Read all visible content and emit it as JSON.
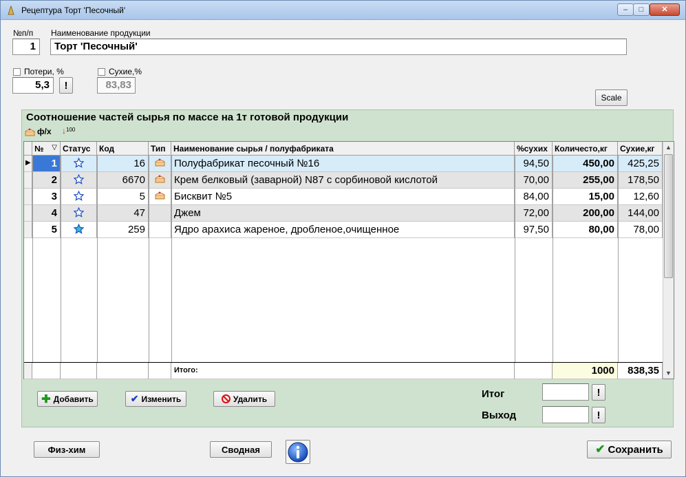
{
  "window": {
    "title": "Рецептура Торт 'Песочный'",
    "controls": {
      "minimize": "–",
      "maximize": "□",
      "close": "✕"
    }
  },
  "form": {
    "num_label": "№п/п",
    "num_value": "1",
    "name_label": "Наименование продукции",
    "name_value": "Торт 'Песочный'",
    "losses_label": "Потери, %",
    "losses_value": "5,3",
    "losses_button": "!",
    "dry_label": "Сухие,%",
    "dry_value": "83,83",
    "scale_button": "Scale"
  },
  "panel": {
    "title": "Соотношение частей сырья по массе на 1т готовой продукции",
    "toolbar_phx": "ф/х",
    "toolbar_sort": "100"
  },
  "grid": {
    "columns": [
      "№",
      "Статус",
      "Код",
      "Тип",
      "Наименование сырья / полуфабриката",
      "%сухих",
      "Количесто,кг",
      "Сухие,кг"
    ],
    "sort_marker": "▽",
    "rows": [
      {
        "num": "1",
        "code": "16",
        "name": "Полуфабрикат песочный №16",
        "dry_pct": "94,50",
        "qty": "450,00",
        "dry_kg": "425,25",
        "type_icon": true,
        "status_filled": false,
        "selected": true
      },
      {
        "num": "2",
        "code": "6670",
        "name": "Крем белковый (заварной) N87 с сорбиновой кислотой",
        "dry_pct": "70,00",
        "qty": "255,00",
        "dry_kg": "178,50",
        "type_icon": true,
        "status_filled": false,
        "selected": false
      },
      {
        "num": "3",
        "code": "5",
        "name": "Бисквит №5",
        "dry_pct": "84,00",
        "qty": "15,00",
        "dry_kg": "12,60",
        "type_icon": true,
        "status_filled": false,
        "selected": false
      },
      {
        "num": "4",
        "code": "47",
        "name": "Джем",
        "dry_pct": "72,00",
        "qty": "200,00",
        "dry_kg": "144,00",
        "type_icon": false,
        "status_filled": false,
        "selected": false
      },
      {
        "num": "5",
        "code": "259",
        "name": "Ядро арахиса жареное, дробленое,очищенное",
        "dry_pct": "97,50",
        "qty": "80,00",
        "dry_kg": "78,00",
        "type_icon": false,
        "status_filled": true,
        "selected": false
      }
    ],
    "footer_label": "Итого:",
    "footer_qty": "1000",
    "footer_dry": "838,35"
  },
  "actions": {
    "add": "Добавить",
    "edit": "Изменить",
    "delete": "Удалить",
    "total_label": "Итог",
    "output_label": "Выход",
    "total_button": "!",
    "output_button": "!"
  },
  "bottom": {
    "physchem": "Физ-хим",
    "summary": "Сводная",
    "save": "Сохранить"
  },
  "colors": {
    "panel_bg": "#cfe2cf",
    "selected_row": "#d7ecf9",
    "alt_row": "#e4e4e4",
    "total_qty_bg": "#fcfde0",
    "star": "#1b4fc4"
  },
  "icons": [
    "app-icon",
    "cake-icon",
    "sort-icon",
    "star-icon",
    "plus-icon",
    "check-icon",
    "forbidden-icon",
    "info-icon"
  ]
}
